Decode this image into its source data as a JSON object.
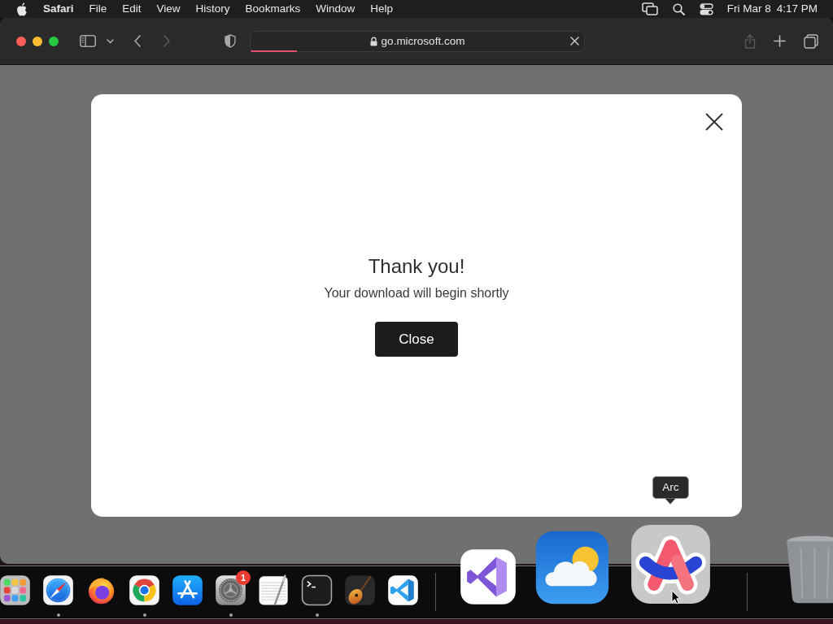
{
  "menu_bar": {
    "app_name": "Safari",
    "menus": [
      "File",
      "Edit",
      "View",
      "History",
      "Bookmarks",
      "Window",
      "Help"
    ],
    "date": "Fri Mar 8",
    "time": "4:17 PM"
  },
  "browser": {
    "back": {
      "disabled": false
    },
    "forward": {
      "disabled": true
    },
    "address": "go.microsoft.com",
    "load_progress": {
      "level": 0.14
    },
    "share": {
      "disabled": true
    }
  },
  "dialog": {
    "title": "Thank you!",
    "message": "Your download will begin shortly",
    "button": "Close"
  },
  "dock": {
    "sections": [
      {
        "items": [
          {
            "running": false
          },
          {
            "running": true
          },
          {
            "running": false
          },
          {
            "running": true
          },
          {
            "running": false
          },
          {
            "running": true,
            "badge": "1"
          },
          {
            "running": false
          },
          {
            "running": true
          },
          {
            "running": false
          },
          {
            "running": false
          }
        ]
      },
      {
        "items": [
          {
            "running": false
          },
          {
            "running": false
          },
          {
            "running": false,
            "tooltip": "Arc"
          }
        ]
      },
      {
        "items": [
          {
            "running": false
          }
        ]
      }
    ]
  }
}
